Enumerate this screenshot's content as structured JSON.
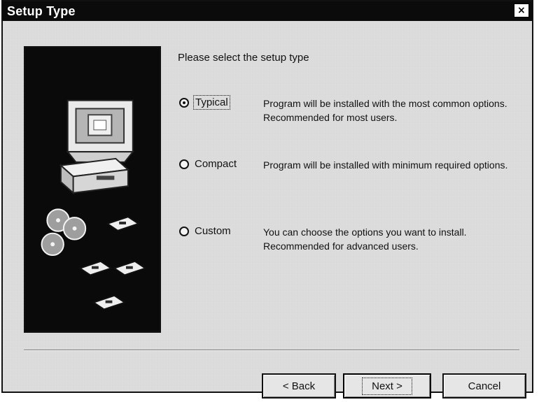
{
  "window": {
    "title": "Setup Type",
    "close_label": "×"
  },
  "main": {
    "prompt": "Please select the setup type",
    "options": [
      {
        "label": "Typical",
        "selected": true,
        "description": "Program will be installed with the most common options.  Recommended for most users."
      },
      {
        "label": "Compact",
        "selected": false,
        "description": "Program will be installed with minimum required options."
      },
      {
        "label": "Custom",
        "selected": false,
        "description": "You can choose the options you want to install. Recommended for advanced users."
      }
    ]
  },
  "buttons": {
    "back_label": "< Back",
    "next_label": "Next >",
    "cancel_label": "Cancel"
  },
  "colors": {
    "title_bar": "#0b0b0b",
    "dialog_bg": "#dcdcdc",
    "art_bg": "#0a0a0a"
  },
  "icons": {
    "close": "close-icon",
    "radio": "radio-button-icon",
    "art": "computer-and-disks-illustration"
  }
}
